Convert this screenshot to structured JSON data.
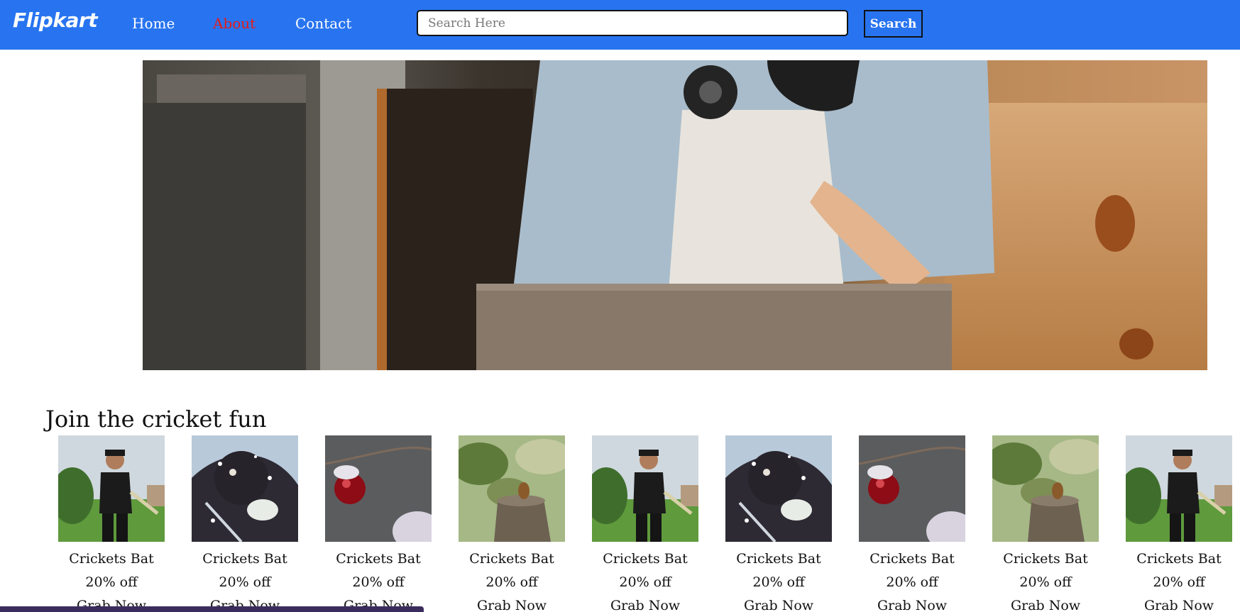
{
  "nav": {
    "logo": "Flipkart",
    "links": [
      {
        "label": "Home"
      },
      {
        "label": "About"
      },
      {
        "label": "Contact"
      }
    ],
    "active_color": "#e41b17",
    "bar_color": "#2874f0"
  },
  "search": {
    "placeholder": "Search Here",
    "value": "",
    "button_label": "Search"
  },
  "hero": {
    "image": "man-with-headphones-laptop-photo"
  },
  "section": {
    "title": "Join the cricket fun"
  },
  "products": [
    {
      "image": "man-holding-bat-photo",
      "name": "Crickets Bat",
      "discount": "20% off",
      "cta": "Grab Now"
    },
    {
      "image": "dog-in-snow-photo",
      "name": "Crickets Bat",
      "discount": "20% off",
      "cta": "Grab Now"
    },
    {
      "image": "red-berry-snow-photo",
      "name": "Crickets Bat",
      "discount": "20% off",
      "cta": "Grab Now"
    },
    {
      "image": "squirrel-on-stump-photo",
      "name": "Crickets Bat",
      "discount": "20% off",
      "cta": "Grab Now"
    },
    {
      "image": "man-holding-bat-photo",
      "name": "Crickets Bat",
      "discount": "20% off",
      "cta": "Grab Now"
    },
    {
      "image": "dog-in-snow-photo",
      "name": "Crickets Bat",
      "discount": "20% off",
      "cta": "Grab Now"
    },
    {
      "image": "red-berry-snow-photo",
      "name": "Crickets Bat",
      "discount": "20% off",
      "cta": "Grab Now"
    },
    {
      "image": "squirrel-on-stump-photo",
      "name": "Crickets Bat",
      "discount": "20% off",
      "cta": "Grab Now"
    },
    {
      "image": "man-holding-bat-photo",
      "name": "Crickets Bat",
      "discount": "20% off",
      "cta": "Grab Now"
    }
  ]
}
